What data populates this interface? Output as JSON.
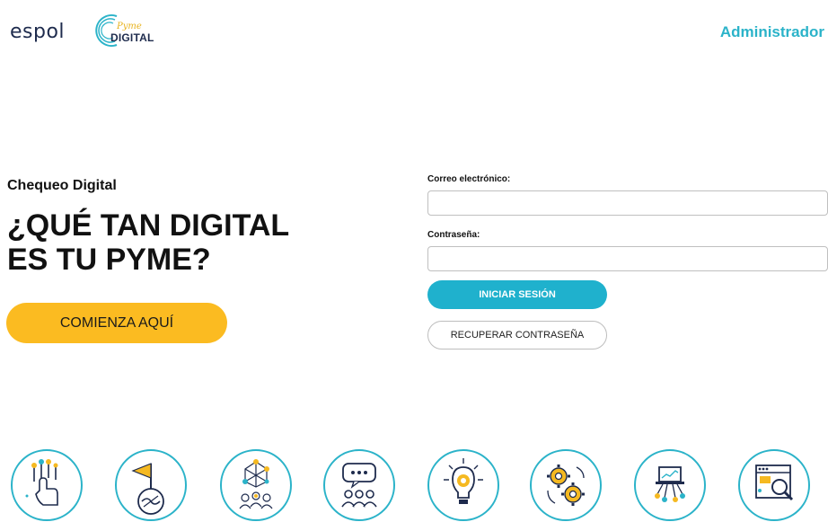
{
  "header": {
    "espol_logo_text": "espol",
    "pyme_logo_script": "Pyme",
    "pyme_logo_text": "DIGITAL",
    "admin_link": "Administrador"
  },
  "hero": {
    "label": "Chequeo Digital",
    "title_line1": "¿QUÉ TAN DIGITAL",
    "title_line2": "ES TU PYME?",
    "cta": "COMIENZA AQUÍ"
  },
  "login": {
    "email_label": "Correo electrónico:",
    "email_value": "",
    "password_label": "Contraseña:",
    "password_value": "",
    "login_button": "INICIAR SESIÓN",
    "recover_button": "RECUPERAR CONTRASEÑA"
  },
  "colors": {
    "accent": "#2bb3c9",
    "cta": "#fbbb21",
    "login_button": "#1fb1cd",
    "icon_yellow": "#f5b921",
    "icon_dark": "#1e2b4d"
  },
  "icons": [
    {
      "name": "touch-network-icon"
    },
    {
      "name": "flag-handshake-icon"
    },
    {
      "name": "team-network-icon"
    },
    {
      "name": "chat-team-icon"
    },
    {
      "name": "idea-bulb-icon"
    },
    {
      "name": "gears-process-icon"
    },
    {
      "name": "computer-network-icon"
    },
    {
      "name": "web-search-icon"
    }
  ]
}
